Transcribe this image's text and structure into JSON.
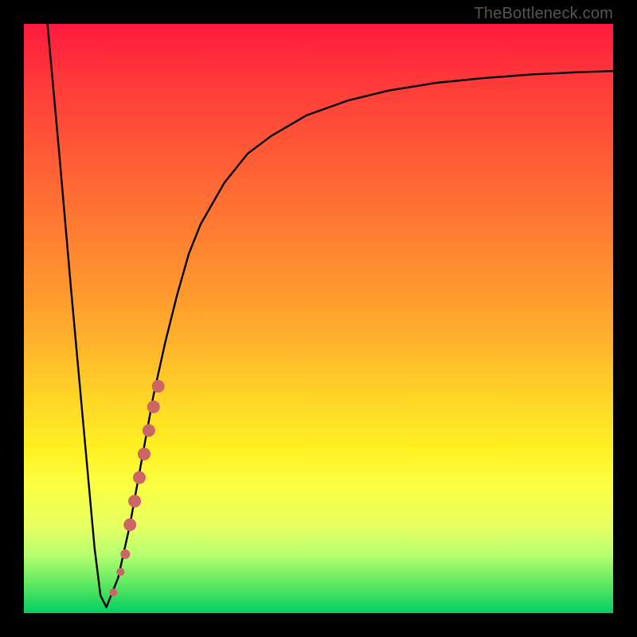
{
  "watermark": "TheBottleneck.com",
  "chart_data": {
    "type": "line",
    "title": "",
    "xlabel": "",
    "ylabel": "",
    "xlim": [
      0,
      100
    ],
    "ylim": [
      0,
      100
    ],
    "series": [
      {
        "name": "bottleneck-curve",
        "x": [
          4,
          6,
          8,
          10,
          12,
          13,
          14,
          16,
          18,
          20,
          22,
          24,
          26,
          28,
          30,
          34,
          38,
          42,
          48,
          55,
          62,
          70,
          78,
          86,
          94,
          100
        ],
        "y": [
          100,
          78,
          55,
          33,
          11,
          3,
          1,
          6,
          15,
          26,
          37,
          46,
          54,
          61,
          66,
          73,
          78,
          81,
          84.5,
          87,
          88.7,
          90,
          90.8,
          91.4,
          91.8,
          92
        ]
      }
    ],
    "markers": {
      "name": "highlight-dots",
      "color": "#cc6666",
      "points": [
        {
          "x": 15.2,
          "y": 3.5,
          "r": 5
        },
        {
          "x": 16.4,
          "y": 7.0,
          "r": 5
        },
        {
          "x": 17.2,
          "y": 10.0,
          "r": 6
        },
        {
          "x": 18.0,
          "y": 15.0,
          "r": 8
        },
        {
          "x": 18.8,
          "y": 19.0,
          "r": 8
        },
        {
          "x": 19.6,
          "y": 23.0,
          "r": 8
        },
        {
          "x": 20.4,
          "y": 27.0,
          "r": 8
        },
        {
          "x": 21.2,
          "y": 31.0,
          "r": 8
        },
        {
          "x": 22.0,
          "y": 35.0,
          "r": 8
        },
        {
          "x": 22.8,
          "y": 38.5,
          "r": 8
        }
      ]
    }
  }
}
